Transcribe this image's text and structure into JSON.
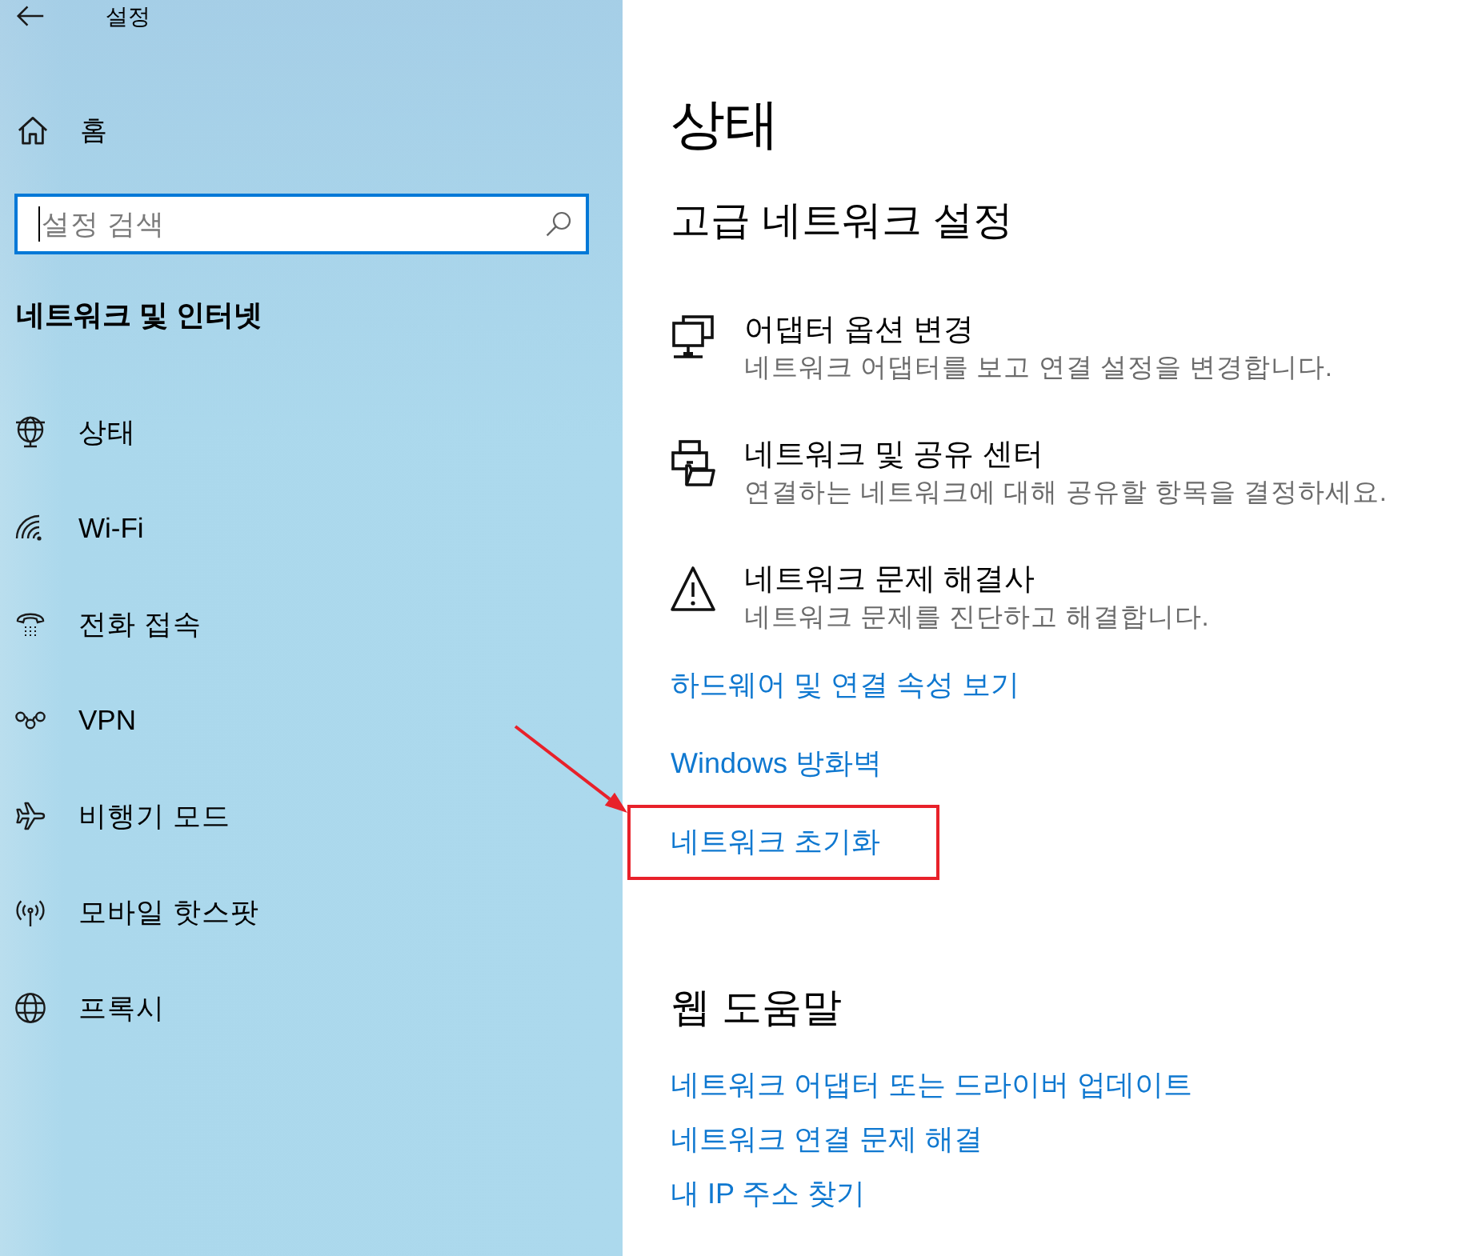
{
  "window": {
    "title": "설정"
  },
  "sidebar": {
    "home": "홈",
    "search": {
      "placeholder": "설정 검색",
      "focused": true
    },
    "section_title": "네트워크 및 인터넷",
    "items": [
      {
        "label": "상태"
      },
      {
        "label": "Wi-Fi"
      },
      {
        "label": "전화 접속"
      },
      {
        "label": "VPN"
      },
      {
        "label": "비행기 모드"
      },
      {
        "label": "모바일 핫스팟"
      },
      {
        "label": "프록시"
      }
    ]
  },
  "content": {
    "title": "상태",
    "advanced": {
      "heading": "고급 네트워크 설정",
      "options": [
        {
          "title": "어댑터 옵션 변경",
          "description": "네트워크 어댑터를 보고 연결 설정을 변경합니다."
        },
        {
          "title": "네트워크 및 공유 센터",
          "description": "연결하는 네트워크에 대해 공유할 항목을 결정하세요."
        },
        {
          "title": "네트워크 문제 해결사",
          "description": "네트워크 문제를 진단하고 해결합니다."
        }
      ],
      "links": [
        {
          "label": "하드웨어 및 연결 속성 보기",
          "highlighted": false
        },
        {
          "label": "Windows 방화벽",
          "highlighted": false
        },
        {
          "label": "네트워크 초기화",
          "highlighted": true
        }
      ]
    },
    "web_help": {
      "heading": "웹 도움말",
      "links": [
        "네트워크 어댑터 또는 드라이버 업데이트",
        "네트워크 연결 문제 해결",
        "내 IP 주소 찾기"
      ]
    }
  }
}
